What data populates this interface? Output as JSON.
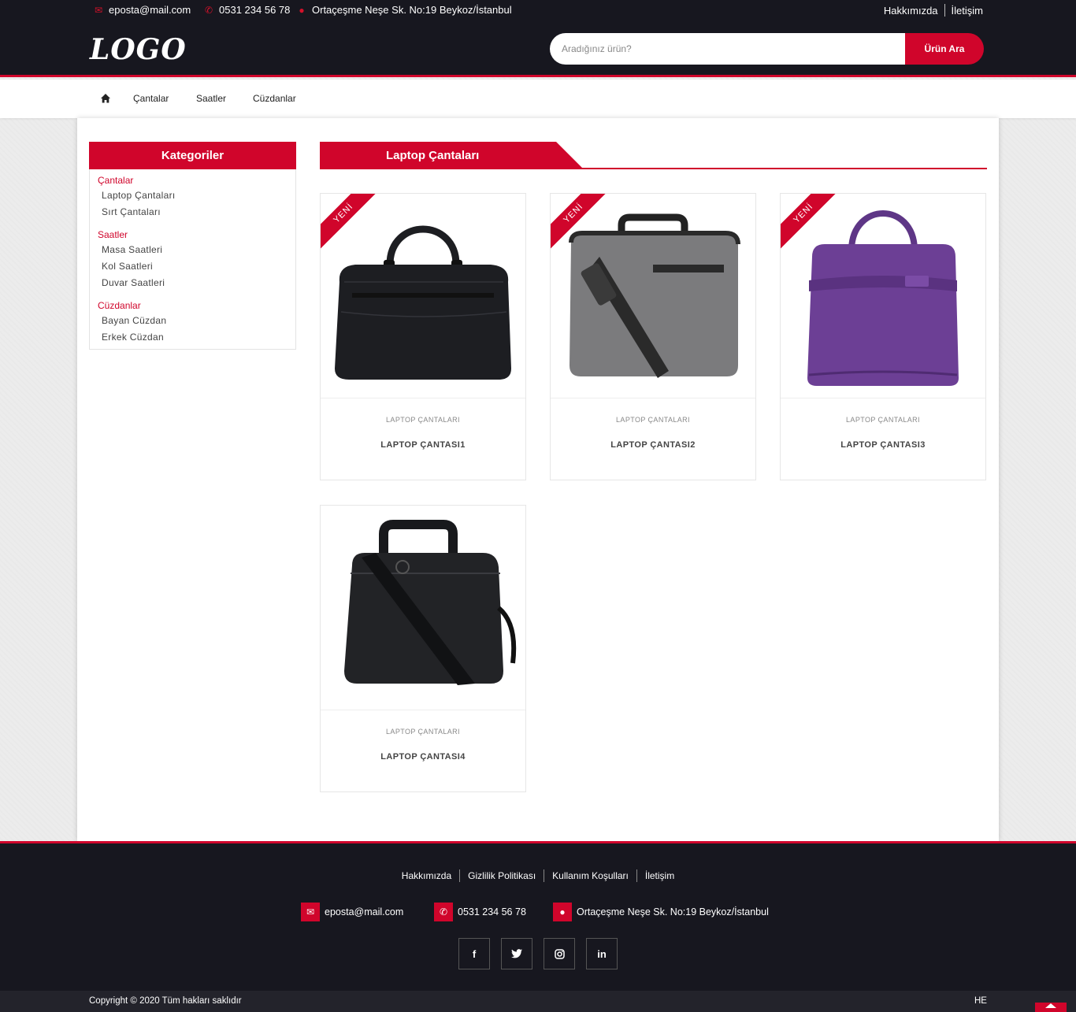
{
  "topbar": {
    "email": "eposta@mail.com",
    "phone": "0531 234 56 78",
    "address": "Ortaçeşme Neşe Sk. No:19 Beykoz/İstanbul",
    "links": [
      "Hakkımızda",
      "İletişim"
    ]
  },
  "header": {
    "logo": "LOGO",
    "search_placeholder": "Aradığınız ürün?",
    "search_button": "Ürün Ara"
  },
  "nav": {
    "home_icon": "home-icon",
    "items": [
      "Çantalar",
      "Saatler",
      "Cüzdanlar"
    ]
  },
  "sidebar": {
    "title": "Kategoriler",
    "groups": [
      {
        "label": "Çantalar",
        "items": [
          "Laptop Çantaları",
          "Sırt Çantaları"
        ]
      },
      {
        "label": "Saatler",
        "items": [
          "Masa Saatleri",
          "Kol Saatleri",
          "Duvar Saatleri"
        ]
      },
      {
        "label": "Cüzdanlar",
        "items": [
          "Bayan Cüzdan",
          "Erkek Cüzdan"
        ]
      }
    ]
  },
  "main": {
    "title": "Laptop Çantaları",
    "products": [
      {
        "badge": "YENİ",
        "category": "LAPTOP ÇANTALARI",
        "name": "LAPTOP ÇANTASI1",
        "color": "#1d1e22"
      },
      {
        "badge": "YENİ",
        "category": "LAPTOP ÇANTALARI",
        "name": "LAPTOP ÇANTASI2",
        "color": "#7b7b7d"
      },
      {
        "badge": "YENİ",
        "category": "LAPTOP ÇANTALARI",
        "name": "LAPTOP ÇANTASI3",
        "color": "#6c3f95"
      },
      {
        "badge": "",
        "category": "LAPTOP ÇANTALARI",
        "name": "LAPTOP ÇANTASI4",
        "color": "#222326"
      }
    ]
  },
  "footer": {
    "links": [
      "Hakkımızda",
      "Gizlilik Politikası",
      "Kullanım Koşulları",
      "İletişim"
    ],
    "email": "eposta@mail.com",
    "phone": "0531 234 56 78",
    "address": "Ortaçeşme Neşe Sk. No:19 Beykoz/İstanbul",
    "social": [
      "facebook-icon",
      "twitter-icon",
      "instagram-icon",
      "linkedin-icon"
    ],
    "copyright": "Copyright © 2020 Tüm hakları saklıdır",
    "credit": "HE"
  },
  "colors": {
    "accent": "#d0052b",
    "dark": "#17171f"
  }
}
